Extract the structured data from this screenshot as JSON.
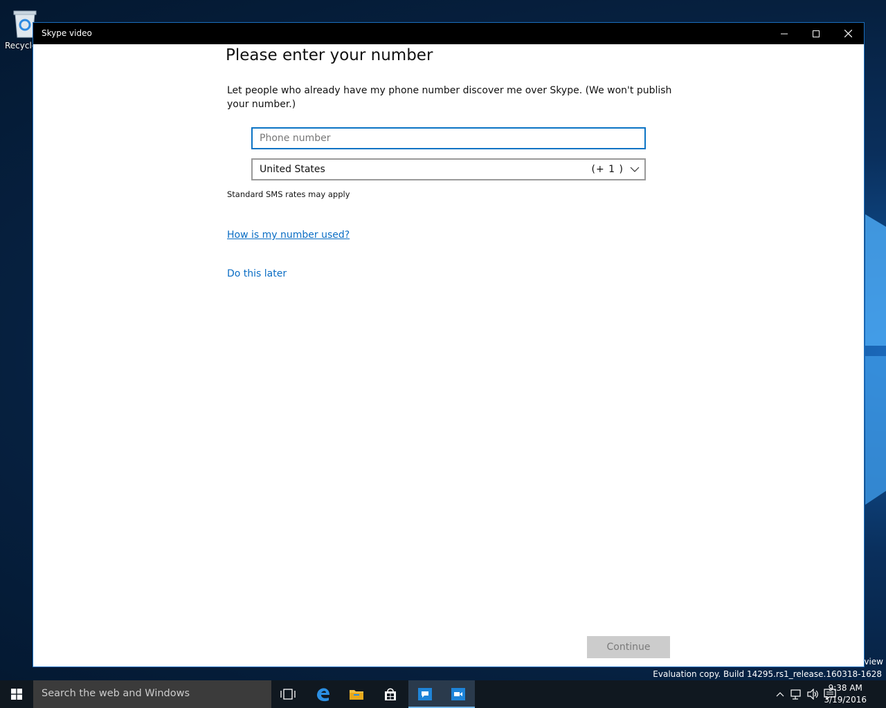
{
  "desktop": {
    "recycle_label": "Recycle",
    "watermark_partial": "eview",
    "watermark": "Evaluation copy. Build 14295.rs1_release.160318-1628"
  },
  "window": {
    "title": "Skype video",
    "controls": [
      "minimize-icon",
      "maximize-icon",
      "close-icon"
    ]
  },
  "main": {
    "heading": "Please enter your number",
    "description": "Let people who already have my phone number discover me over Skype. (We won't publish your number.)",
    "phone_placeholder": "Phone number",
    "phone_value": "",
    "country": "United States",
    "country_code": "(+ 1 )",
    "sms_note": "Standard SMS rates may apply",
    "how_link": "How is my number used?",
    "later_link": "Do this later",
    "continue_label": "Continue"
  },
  "taskbar": {
    "search_placeholder": "Search the web and Windows",
    "apps": [
      "task-view-icon",
      "edge-icon",
      "file-explorer-icon",
      "store-icon",
      "messaging-icon",
      "skype-video-icon"
    ],
    "time": "9:38 AM",
    "date": "3/19/2016"
  },
  "colors": {
    "accent": "#0a73c4",
    "link": "#0a6dc4",
    "titlebar": "#000000",
    "taskbar": "#101820",
    "button_disabled": "#cccccc"
  }
}
